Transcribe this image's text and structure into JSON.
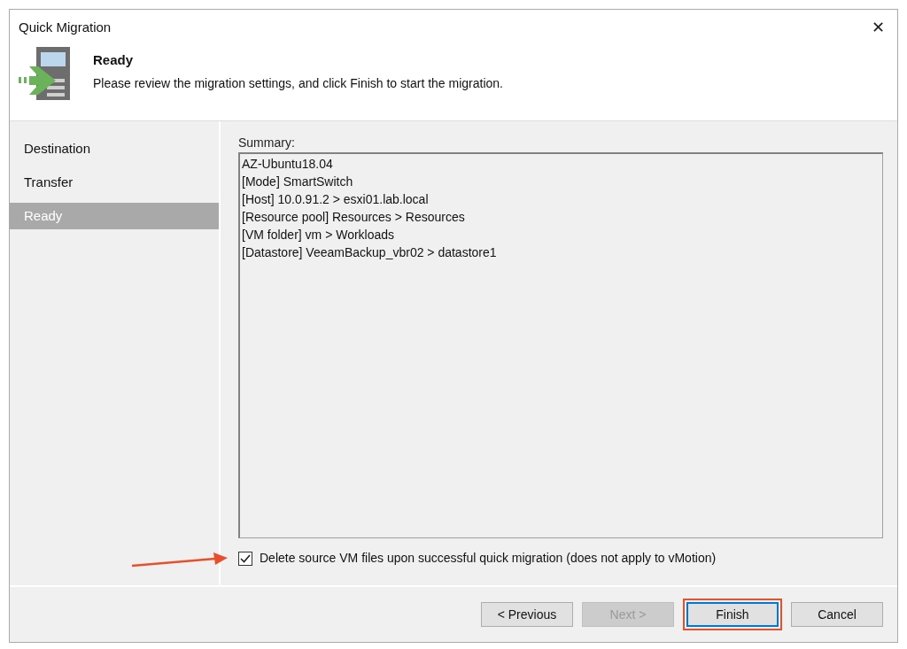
{
  "window": {
    "title": "Quick Migration",
    "close": "✕"
  },
  "header": {
    "title": "Ready",
    "description": "Please review the migration settings, and click Finish to start the migration."
  },
  "sidebar": {
    "items": [
      {
        "label": "Destination",
        "selected": false
      },
      {
        "label": "Transfer",
        "selected": false
      },
      {
        "label": "Ready",
        "selected": true
      }
    ]
  },
  "summary": {
    "label": "Summary:",
    "lines": [
      "AZ-Ubuntu18.04",
      "[Mode] SmartSwitch",
      "[Host] 10.0.91.2 > esxi01.lab.local",
      "[Resource pool] Resources > Resources",
      "[VM folder] vm > Workloads",
      "[Datastore] VeeamBackup_vbr02 > datastore1"
    ]
  },
  "delete_source": {
    "label": "Delete source VM files upon successful quick migration (does not apply to vMotion)",
    "checked": true,
    "annotated": true
  },
  "buttons": [
    {
      "label": "< Previous",
      "disabled": false,
      "default": false,
      "annotated": false
    },
    {
      "label": "Next >",
      "disabled": true,
      "default": false,
      "annotated": false
    },
    {
      "label": "Finish",
      "disabled": false,
      "default": true,
      "annotated": true
    },
    {
      "label": "Cancel",
      "disabled": false,
      "default": false,
      "annotated": false
    }
  ]
}
